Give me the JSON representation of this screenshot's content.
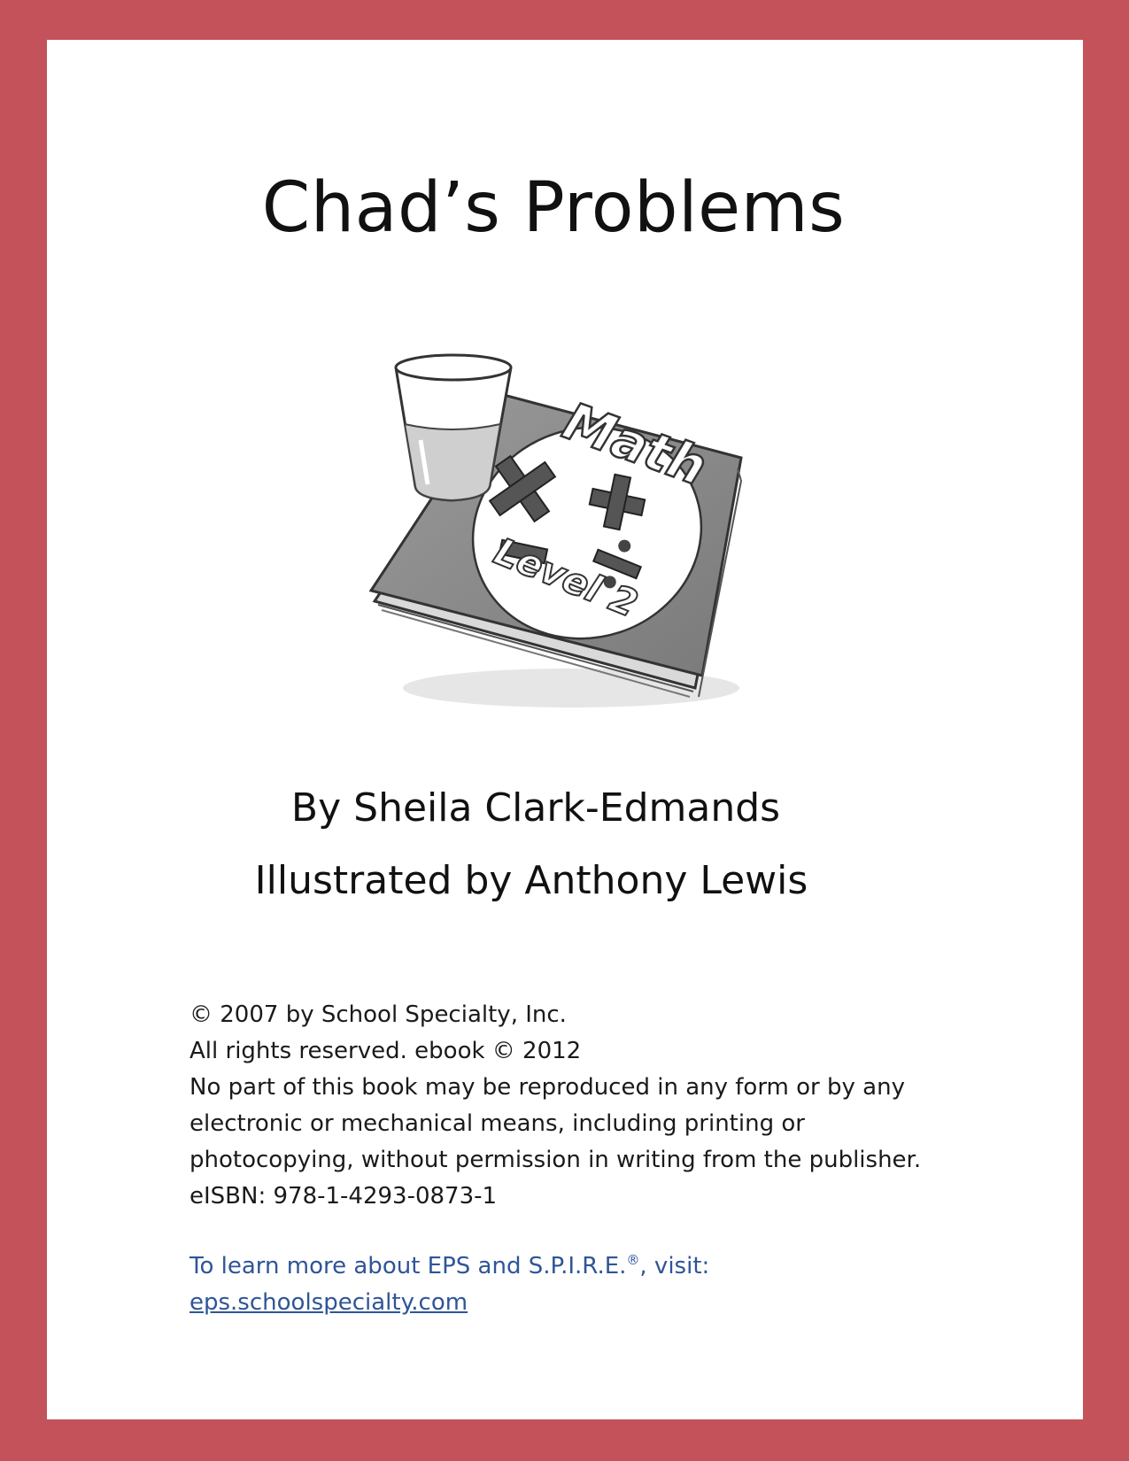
{
  "title": "Chad’s Problems",
  "illustration": {
    "book_title": "Math",
    "book_level": "Level 2",
    "symbols": [
      "×",
      "+",
      "−",
      "÷"
    ]
  },
  "credits": {
    "author": "By Sheila Clark-Edmands",
    "illustrator": "Illustrated by Anthony Lewis"
  },
  "legal": {
    "copyright": "© 2007 by School Specialty, Inc.",
    "rights": "All rights reserved. ebook © 2012",
    "notice_line1": "No part of this book may be reproduced in any form or by any",
    "notice_line2": "electronic or mechanical means, including printing or",
    "notice_line3": "photocopying, without permission in writing from the publisher.",
    "isbn": "eISBN: 978-1-4293-0873-1"
  },
  "more_info": {
    "text_before": "To learn more about EPS and S.P.I.R.E.",
    "registered": "®",
    "text_after": ", visit:",
    "link": "eps.schoolspecialty.com"
  },
  "colors": {
    "frame": "#c4525b",
    "page": "#ffffff",
    "link": "#2f5597"
  }
}
